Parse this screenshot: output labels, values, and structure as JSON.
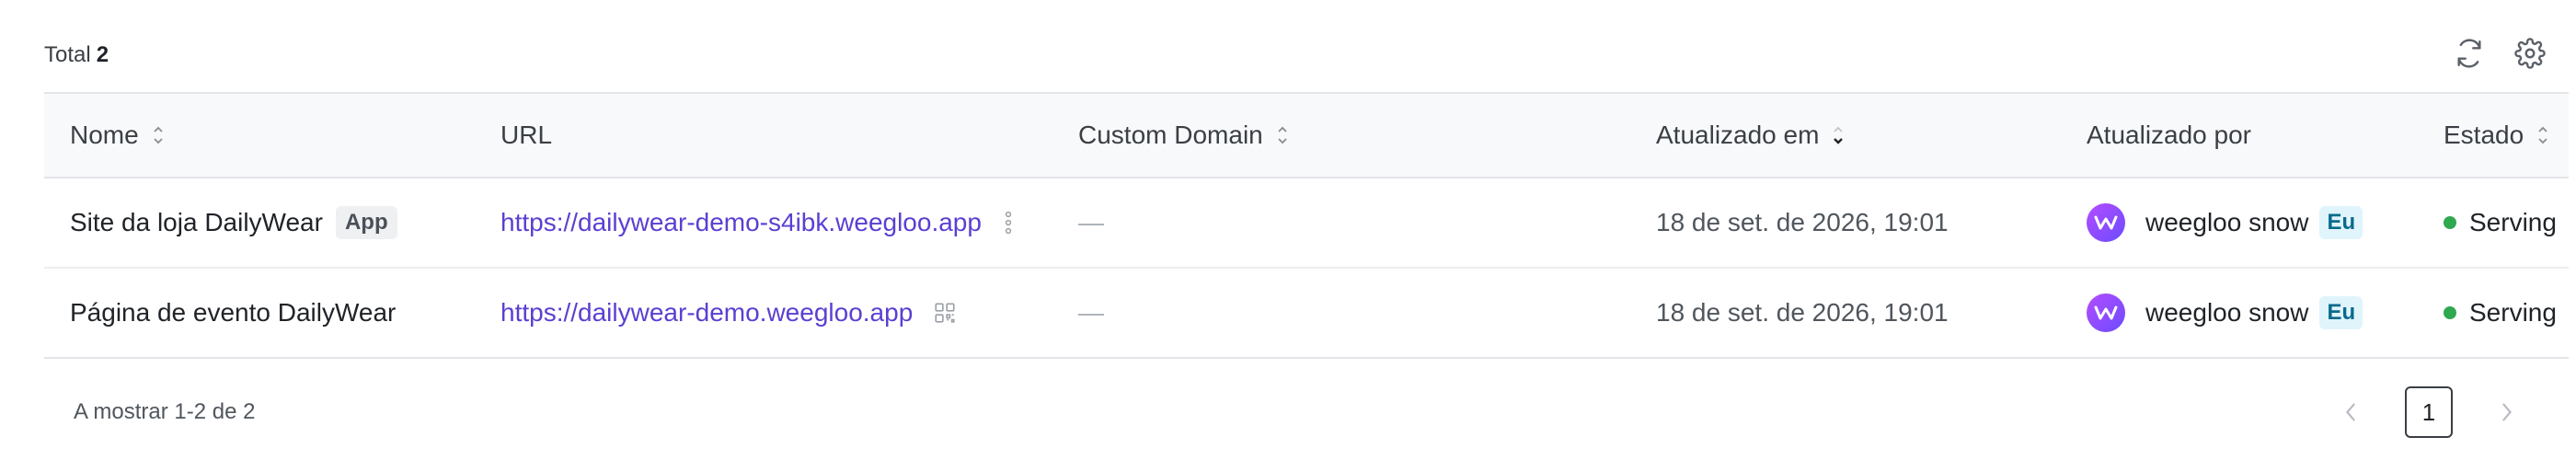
{
  "header": {
    "total_label": "Total",
    "total_count": "2"
  },
  "toolbar": {
    "refresh_icon": "refresh-icon",
    "settings_icon": "gear-icon"
  },
  "columns": [
    {
      "label": "Nome",
      "sortable": true
    },
    {
      "label": "URL",
      "sortable": false
    },
    {
      "label": "Custom Domain",
      "sortable": true
    },
    {
      "label": "Atualizado em",
      "sortable": true,
      "sorted": "desc"
    },
    {
      "label": "Atualizado por",
      "sortable": false
    },
    {
      "label": "Estado",
      "sortable": true
    }
  ],
  "rows": [
    {
      "name": "Site da loja DailyWear",
      "tag": "App",
      "url": "https://dailywear-demo-s4ibk.weegloo.app",
      "url_action_icon": "more-vertical-icon",
      "custom_domain": "—",
      "updated_at": "18 de set. de 2026, 19:01",
      "updated_by": "weegloo snow",
      "updated_by_badge": "Eu",
      "status": "Serving"
    },
    {
      "name": "Página de evento DailyWear",
      "tag": "",
      "url": "https://dailywear-demo.weegloo.app",
      "url_action_icon": "qr-code-icon",
      "custom_domain": "—",
      "updated_at": "18 de set. de 2026, 19:01",
      "updated_by": "weegloo snow",
      "updated_by_badge": "Eu",
      "status": "Serving"
    }
  ],
  "footer": {
    "showing": "A mostrar 1-2 de 2",
    "current_page": "1"
  },
  "colors": {
    "link": "#5b3fd1",
    "status_serving": "#2fa84f",
    "eu_badge_bg": "#e0f4fb"
  }
}
